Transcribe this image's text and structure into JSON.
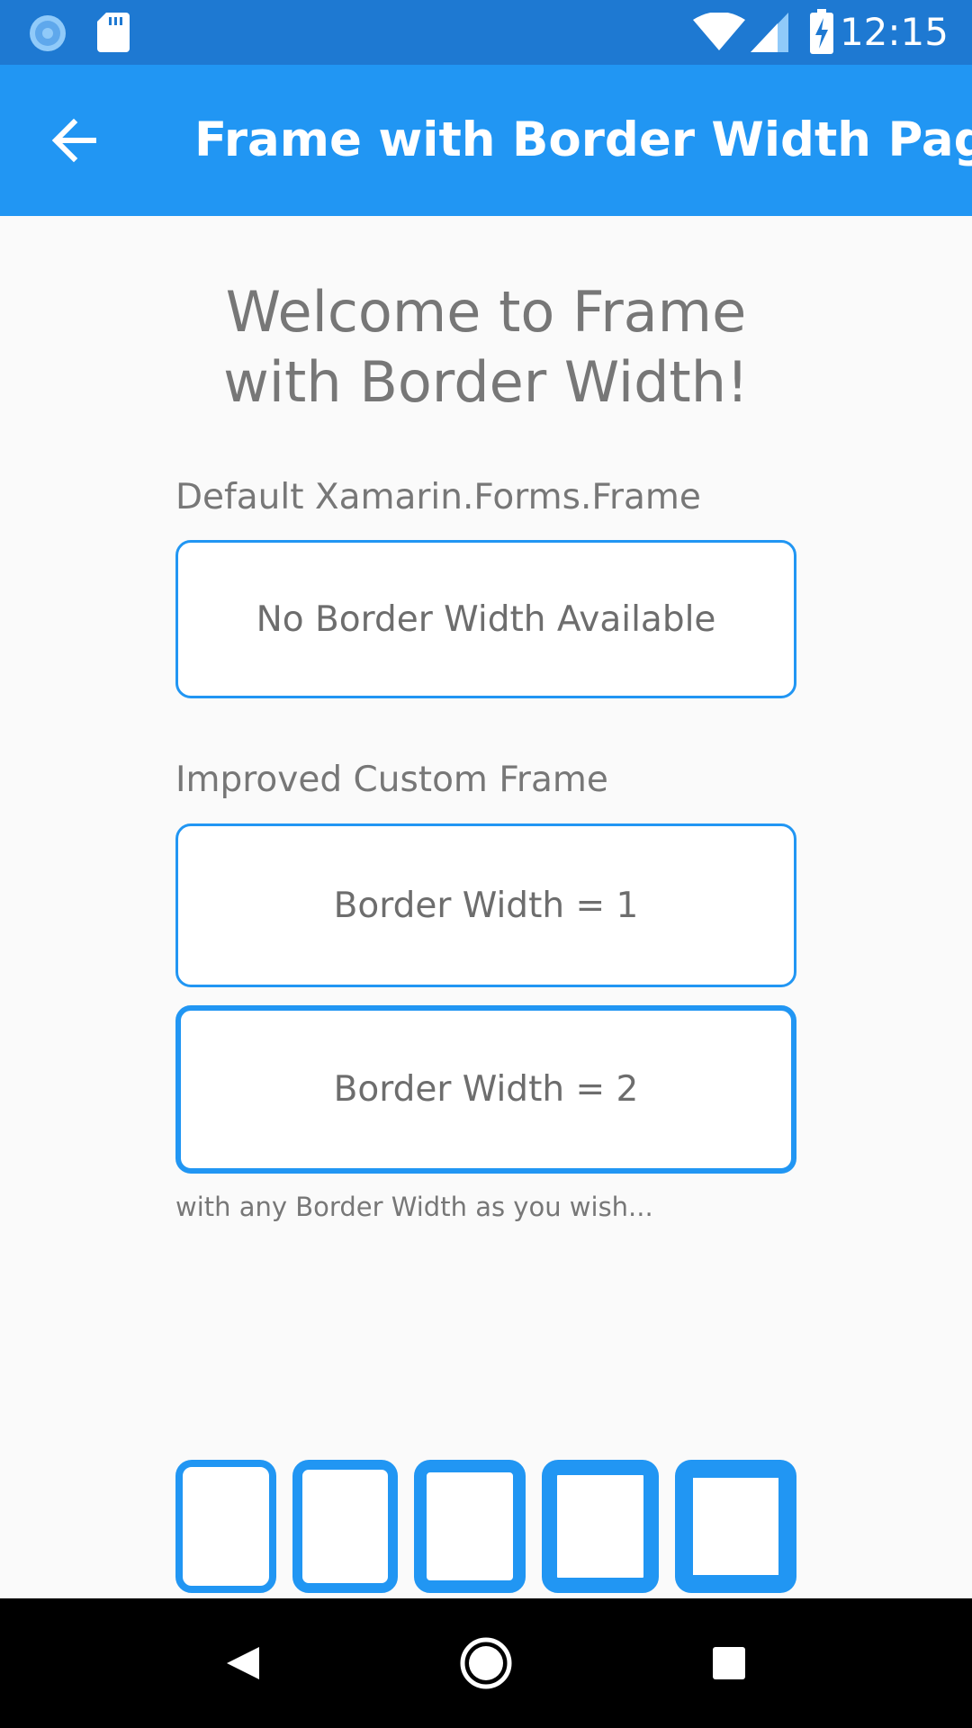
{
  "status_bar": {
    "time": "12:15",
    "left_icons": [
      "sync-icon",
      "sd-card-icon"
    ],
    "right_icons": [
      "wifi-icon",
      "cell-signal-icon",
      "battery-charging-icon"
    ]
  },
  "app_bar": {
    "title": "Frame with Border Width Page",
    "back_icon": "arrow-back-icon",
    "background_color": "#2196f3"
  },
  "main": {
    "welcome": "Welcome to Frame with Border Width!",
    "default_section": {
      "label": "Default Xamarin.Forms.Frame",
      "frame_text": "No Border Width Available"
    },
    "custom_section": {
      "label": "Improved Custom Frame",
      "frames": [
        {
          "text": "Border Width = 1"
        },
        {
          "text": "Border Width = 2"
        }
      ]
    },
    "hint": "with any Border Width as you wish...",
    "example_frames_count": 5,
    "accent_color": "#2196f3"
  },
  "nav_bar": {
    "icons": [
      "back-triangle-icon",
      "home-circle-icon",
      "recents-square-icon"
    ]
  }
}
